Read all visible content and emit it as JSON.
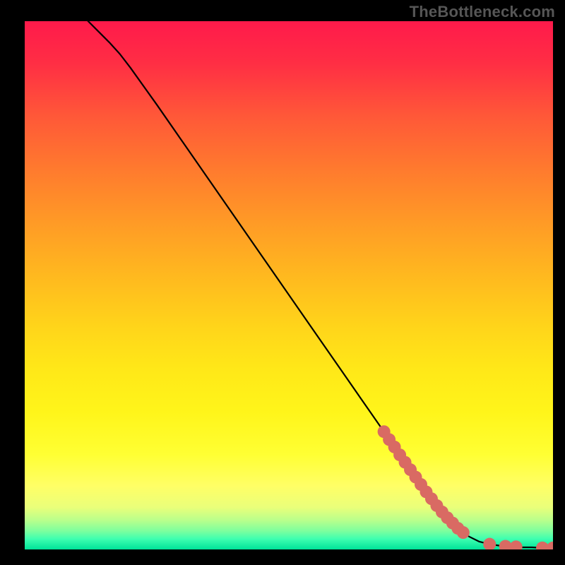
{
  "attribution": "TheBottleneck.com",
  "chart_data": {
    "type": "line",
    "title": "",
    "xlabel": "",
    "ylabel": "",
    "xlim": [
      0,
      100
    ],
    "ylim": [
      0,
      100
    ],
    "grid": false,
    "curve": {
      "name": "curve",
      "color": "#000000",
      "x": [
        12,
        14,
        16,
        18,
        20,
        25,
        30,
        35,
        40,
        45,
        50,
        55,
        60,
        65,
        68,
        70,
        72,
        74,
        76,
        78,
        80,
        82,
        84,
        86,
        88,
        90,
        92,
        94,
        96,
        98,
        100
      ],
      "y": [
        100,
        98,
        96,
        93.8,
        91.2,
        84.2,
        77,
        69.8,
        62.6,
        55.4,
        48.2,
        41,
        33.8,
        26.6,
        22.3,
        19.4,
        16.5,
        13.7,
        10.9,
        8.3,
        6.0,
        4.0,
        2.5,
        1.5,
        1.0,
        0.7,
        0.5,
        0.4,
        0.4,
        0.3,
        0.3
      ]
    },
    "markers": {
      "name": "highlight-points",
      "color": "#d96a63",
      "x": [
        68,
        69,
        70,
        71,
        72,
        73,
        74,
        75,
        76,
        77,
        78,
        79,
        80,
        81,
        82,
        83,
        88,
        91,
        93,
        98,
        100
      ],
      "y": [
        22.3,
        20.8,
        19.4,
        17.9,
        16.5,
        15.1,
        13.7,
        12.3,
        10.9,
        9.6,
        8.3,
        7.1,
        6.0,
        5.0,
        4.0,
        3.2,
        1.0,
        0.6,
        0.5,
        0.3,
        0.3
      ]
    }
  }
}
